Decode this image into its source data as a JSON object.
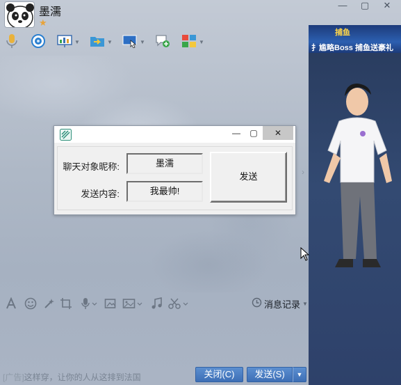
{
  "window": {
    "nickname": "墨濡",
    "star": "★",
    "controls": [
      "—",
      "▢",
      "✕"
    ]
  },
  "toolbar": {
    "items": [
      "microphone-icon",
      "video-icon",
      "screen-share-icon",
      "folder-transfer-icon",
      "remote-desktop-icon",
      "new-chat-icon",
      "apps-icon"
    ]
  },
  "ad_panel": {
    "banner_logo": "捕鱼",
    "banner_text": "扌尴略Boss 捕鱼送豪礼"
  },
  "dialog": {
    "title_controls": {
      "minimize": "—",
      "maximize": "▢",
      "close": "✕"
    },
    "nickname_label": "聊天对象昵称:",
    "nickname_value": "墨濡",
    "content_label": "发送内容:",
    "content_value": "我最帅!",
    "send_label": "发送"
  },
  "input_toolbar": {
    "message_record": "消息记录"
  },
  "footer": {
    "ad_tag": "[广告]",
    "ad_text": "这样穿，让你的人从这排到法国",
    "close_label": "关闭(C)",
    "send_label": "发送(S)",
    "send_dropdown": "▼"
  },
  "colors": {
    "button_blue": "#4a7dc2",
    "ad_panel": "#2e416a",
    "dialog_bg": "#f0f0f0"
  }
}
